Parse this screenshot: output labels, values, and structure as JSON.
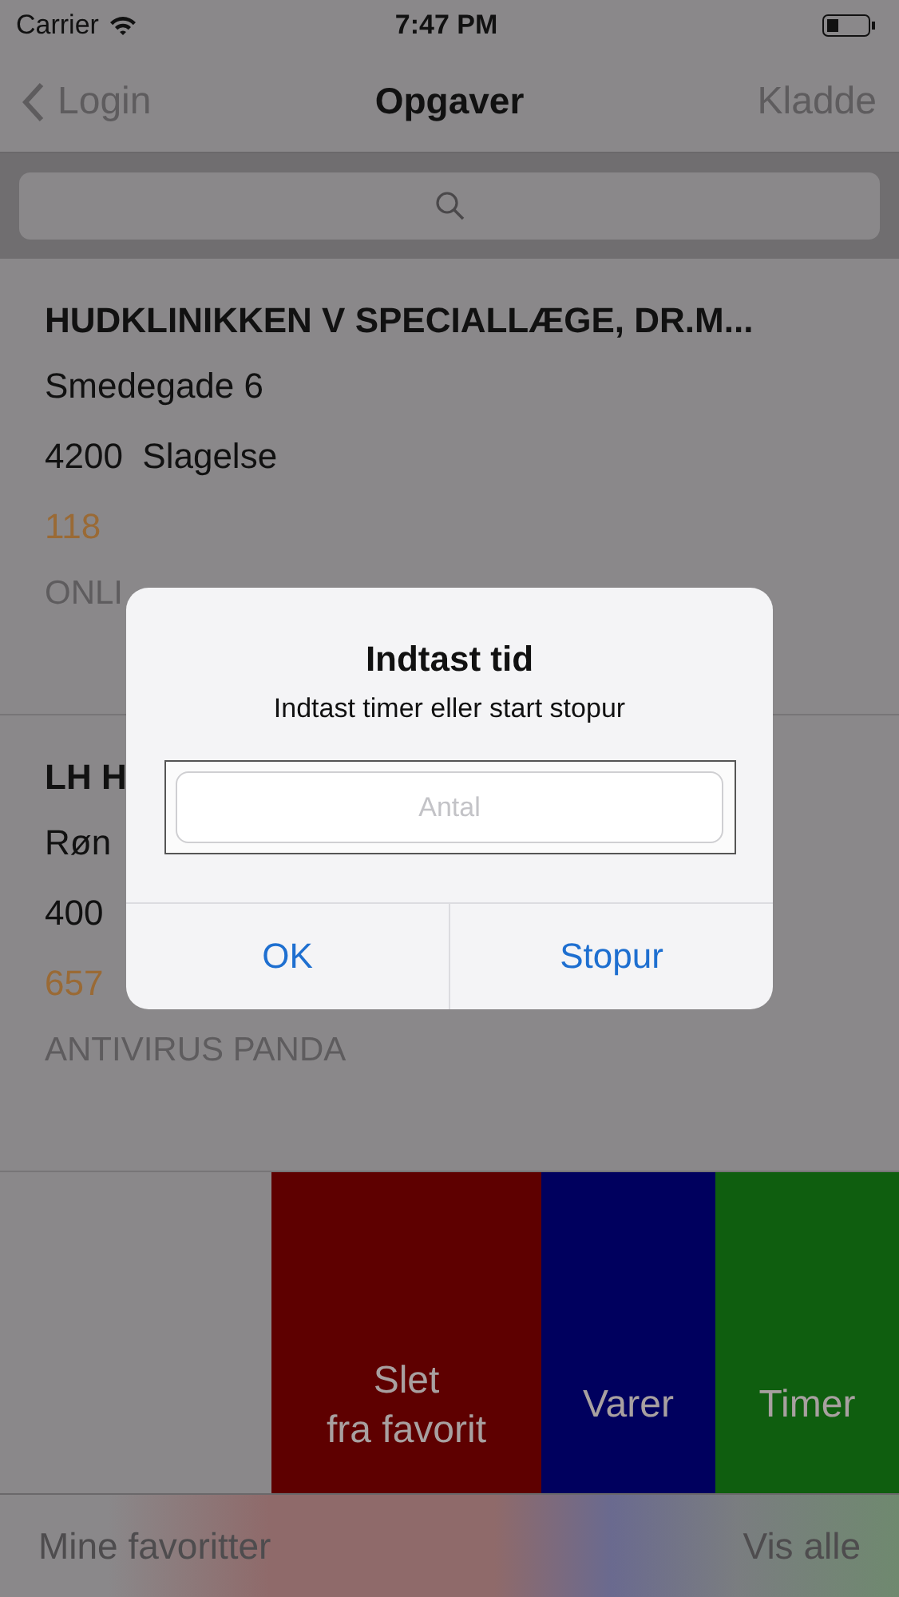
{
  "status_bar": {
    "carrier": "Carrier",
    "time": "7:47 PM"
  },
  "nav_bar": {
    "back": "Login",
    "title": "Opgaver",
    "right": "Kladde"
  },
  "tasks": [
    {
      "name": "HUDKLINIKKEN V SPECIALLÆGE, DR.M...",
      "address": "Smedegade 6",
      "city": "4200  Slagelse",
      "number": "118",
      "product": "ONLI"
    },
    {
      "name": "LH H",
      "address": "Røn",
      "city": "400",
      "number": "657",
      "product": "ANTIVIRUS PANDA"
    }
  ],
  "swipe_actions": [
    {
      "label": "Slet\nfra favorit",
      "color": "#5e0000"
    },
    {
      "label": "Varer",
      "color": "#00005e"
    },
    {
      "label": "Timer",
      "color": "#0f5e0f"
    }
  ],
  "dialog": {
    "title": "Indtast tid",
    "message": "Indtast timer eller start stopur",
    "placeholder": "Antal",
    "buttons": [
      "OK",
      "Stopur"
    ]
  },
  "toolbar": {
    "left": "Mine favoritter",
    "right": "Vis alle"
  }
}
